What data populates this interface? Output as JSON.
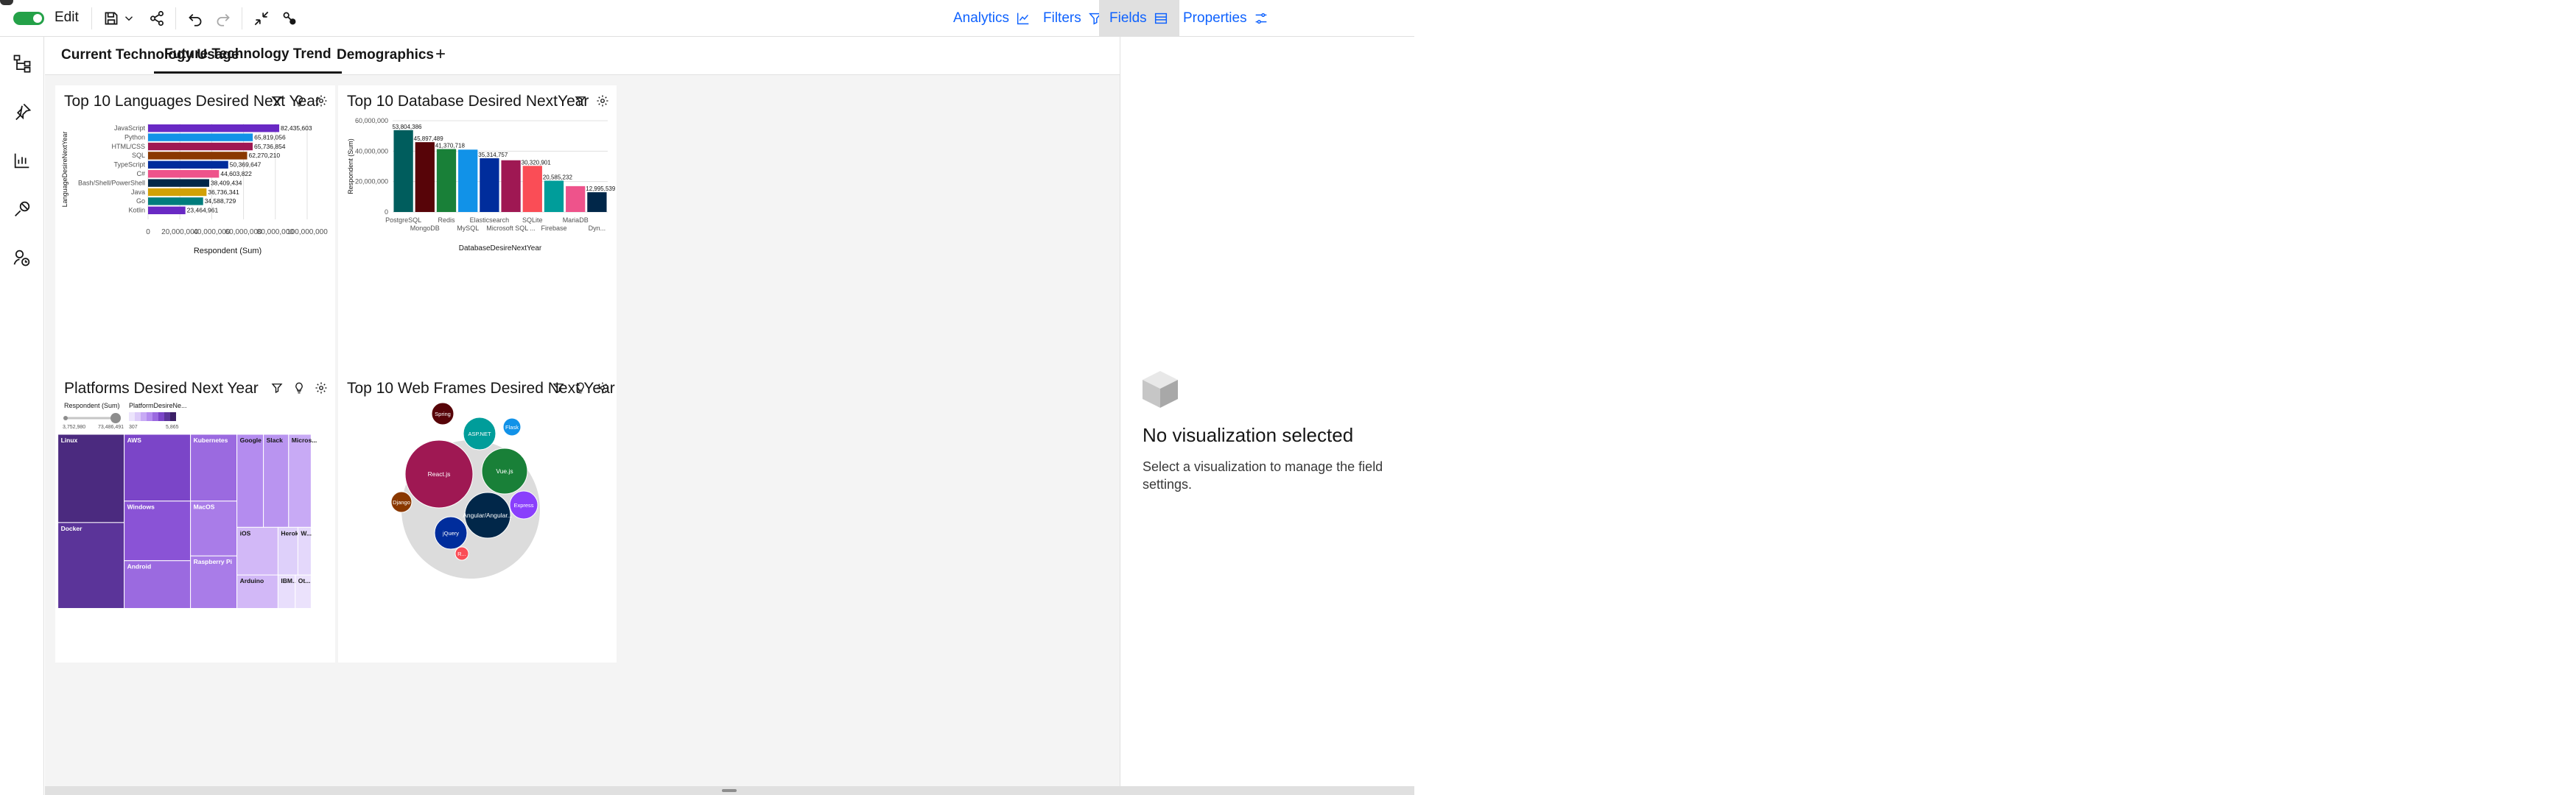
{
  "toolbar": {
    "edit_label": "Edit",
    "analytics_label": "Analytics",
    "filters_label": "Filters",
    "fields_label": "Fields",
    "properties_label": "Properties"
  },
  "tabs": [
    {
      "label": "Current Technology Usage",
      "active": false
    },
    {
      "label": "Future Technology Trend",
      "active": true
    },
    {
      "label": "Demographics",
      "active": false
    }
  ],
  "tab_add": "+",
  "right_panel": {
    "title": "No visualization selected",
    "body": "Select a visualization to manage the field settings."
  },
  "colors": {
    "accent": "#0f62fe",
    "toggle_on": "#24a148"
  },
  "charts": {
    "languages": {
      "title": "Top 10 Languages Desired Next Year",
      "chart_data": {
        "type": "bar",
        "orientation": "horizontal",
        "categories": [
          "JavaScript",
          "Python",
          "HTML/CSS",
          "SQL",
          "TypeScript",
          "C#",
          "Bash/Shell/PowerShell",
          "Java",
          "Go",
          "Kotlin"
        ],
        "values": [
          82435603,
          65819056,
          65736854,
          62270210,
          50369647,
          44603822,
          38409434,
          36736341,
          34588729,
          23464961
        ],
        "value_labels": [
          "82,435,603",
          "65,819,056",
          "65,736,854",
          "62,270,210",
          "50,369,647",
          "44,603,822",
          "38,409,434",
          "36,736,341",
          "34,588,729",
          "23,464,961"
        ],
        "colors": [
          "#6929c4",
          "#1192e8",
          "#9f1853",
          "#8a3800",
          "#002d9c",
          "#ee538b",
          "#012749",
          "#d2a106",
          "#017d7d",
          "#6929c4"
        ],
        "xlabel": "Respondent (Sum)",
        "ylabel": "LanguageDesireNextYear",
        "xticks": [
          "0",
          "20,000,000",
          "40,000,000",
          "60,000,000",
          "80,000,000",
          "100,000,000"
        ],
        "xlim": [
          0,
          100000000
        ],
        "grid": true
      }
    },
    "databases": {
      "title": "Top 10 Database Desired NextYear",
      "chart_data": {
        "type": "bar",
        "orientation": "vertical",
        "categories": [
          "PostgreSQL",
          "MongoDB",
          "Redis",
          "MySQL",
          "Elasticsearch",
          "Microsoft SQL ...",
          "SQLite",
          "Firebase",
          "MariaDB",
          "Dyn..."
        ],
        "values": [
          53804386,
          45897489,
          41370718,
          41000000,
          35314757,
          34000000,
          30320901,
          20585232,
          17000000,
          12995539
        ],
        "value_labels": [
          "53,804,386",
          "45,897,489",
          "41,370,718",
          "",
          "35,314,757",
          "",
          "30,320,901",
          "20,585,232",
          "",
          "12,995,539"
        ],
        "colors": [
          "#005d5d",
          "#570408",
          "#198038",
          "#1192e8",
          "#002d9c",
          "#9f1853",
          "#fa4d56",
          "#009d9a",
          "#ee538b",
          "#012749"
        ],
        "xlabel": "DatabaseDesireNextYear",
        "ylabel": "Respondent (Sum)",
        "yticks": [
          "0",
          "20,000,000",
          "40,000,000",
          "60,000,000"
        ],
        "ylim": [
          0,
          60000000
        ],
        "grid": true
      }
    },
    "platforms": {
      "title": "Platforms Desired Next Year",
      "legend": {
        "size_label": "Respondent (Sum)",
        "size_min": "3,752,980",
        "size_max": "73,486,491",
        "color_label": "PlatformDesireNe...",
        "color_min": "307",
        "color_max": "5,865"
      },
      "chart_data": {
        "type": "treemap",
        "items": [
          {
            "label": "Linux",
            "color": "#4b2a7f"
          },
          {
            "label": "Docker",
            "color": "#5b3499"
          },
          {
            "label": "AWS",
            "color": "#7b45c8"
          },
          {
            "label": "Windows",
            "color": "#8a53d6"
          },
          {
            "label": "Android",
            "color": "#9b6ae0"
          },
          {
            "label": "Kubernetes",
            "color": "#9b6ae0"
          },
          {
            "label": "MacOS",
            "color": "#a97ce8"
          },
          {
            "label": "Raspberry Pi",
            "color": "#a97ce8"
          },
          {
            "label": "Google ...",
            "color": "#b48cef"
          },
          {
            "label": "Slack",
            "color": "#b994f0"
          },
          {
            "label": "Micros...",
            "color": "#c8aaf5"
          },
          {
            "label": "iOS",
            "color": "#d2b8f7"
          },
          {
            "label": "Heroku",
            "color": "#ded0fa"
          },
          {
            "label": "W...",
            "color": "#e4d8fb"
          },
          {
            "label": "Arduino",
            "color": "#d2b8f7"
          },
          {
            "label": "IBM...",
            "color": "#e8defc"
          },
          {
            "label": "Ot...",
            "color": "#ebe2fc"
          }
        ]
      }
    },
    "webframes": {
      "title": "Top 10 Web Frames Desired Next Year",
      "chart_data": {
        "type": "bubble",
        "items": [
          {
            "label": "React.js",
            "color": "#9f1853"
          },
          {
            "label": "Vue.js",
            "color": "#198038"
          },
          {
            "label": "Angular/Angular...",
            "color": "#012749"
          },
          {
            "label": "ASP.NET",
            "color": "#009d9a"
          },
          {
            "label": "jQuery",
            "color": "#002d9c"
          },
          {
            "label": "Express",
            "color": "#8a3ffc"
          },
          {
            "label": "Spring",
            "color": "#570408"
          },
          {
            "label": "Django",
            "color": "#8a3800"
          },
          {
            "label": "Flask",
            "color": "#1192e8"
          },
          {
            "label": "R...",
            "color": "#fa4d56"
          }
        ]
      }
    }
  }
}
